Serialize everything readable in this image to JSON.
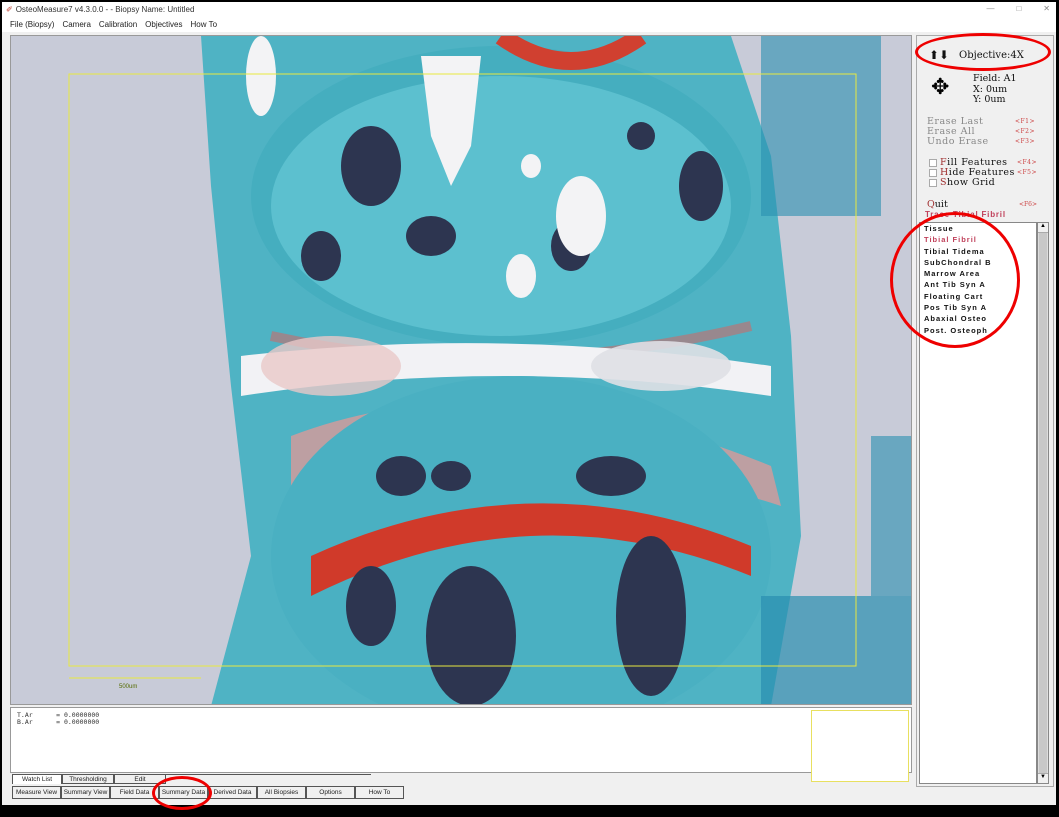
{
  "window": {
    "title": "OsteoMeasure7 v4.3.0.0 - - Biopsy Name: Untitled",
    "icon": "app-logo-icon",
    "controls": [
      "—",
      "□",
      "✕"
    ]
  },
  "menu": [
    "File (Biopsy)",
    "Camera",
    "Calibration",
    "Objectives",
    "How To"
  ],
  "viewer": {
    "scale_bar_label": "500um"
  },
  "panel": {
    "objective": "Objective:4X",
    "field": "Field: A1",
    "x": "X: 0um",
    "y": "Y: 0um",
    "commands": [
      {
        "label": "Erase Last",
        "key": "<F1>"
      },
      {
        "label": "Erase All",
        "key": "<F2>"
      },
      {
        "label": "Undo Erase",
        "key": "<F3>"
      }
    ],
    "checkboxes": [
      {
        "u": "F",
        "rest": "ill Features",
        "key": "<F4>",
        "checked": false
      },
      {
        "u": "H",
        "rest": "ide Features",
        "key": "<F5>",
        "checked": false
      },
      {
        "u": "S",
        "rest": "how Grid",
        "key": "",
        "checked": false
      }
    ],
    "quit": {
      "u": "Q",
      "rest": "uit",
      "key": "<F6>"
    },
    "trace": "Trace Tibial Fibril",
    "features": [
      "Tissue",
      "Tibial Fibril",
      "Tibial Tidema",
      "SubChondral B",
      "Marrow Area",
      "Ant Tib Syn A",
      "Floating Cart",
      "Pos Tib Syn A",
      "Abaxial Osteo",
      "Post. Osteoph"
    ],
    "selected_feature": 1
  },
  "watch": {
    "lines": [
      "T.Ar      = 0.0000000",
      "B.Ar      = 0.0000000"
    ]
  },
  "tabs_top": [
    "Watch List",
    "Thresholding",
    "Edit"
  ],
  "tabs_bottom": [
    "Measure View",
    "Summary View",
    "Field Data",
    "Summary Data",
    "Derived Data",
    "All Biopsies",
    "Options",
    "How To"
  ]
}
